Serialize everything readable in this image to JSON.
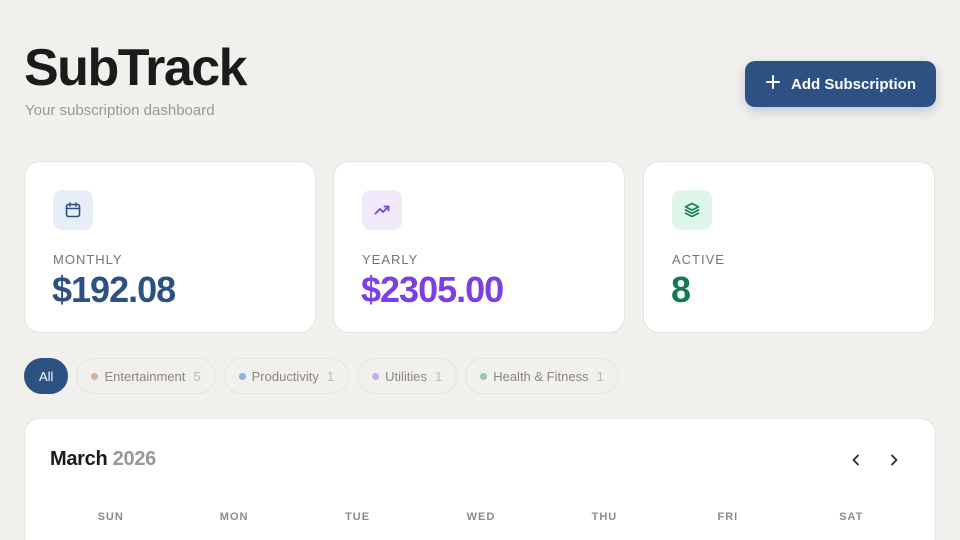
{
  "header": {
    "title": "SubTrack",
    "subtitle": "Your subscription dashboard",
    "add_button_label": "Add Subscription"
  },
  "stats": [
    {
      "label": "MONTHLY",
      "value": "$192.08",
      "icon": "calendar-icon",
      "color": "#2e5184",
      "icon_bg": "#e8eef7"
    },
    {
      "label": "YEARLY",
      "value": "$2305.00",
      "icon": "trending-up-icon",
      "color": "#7b3fe4",
      "icon_bg": "#f0eafb"
    },
    {
      "label": "ACTIVE",
      "value": "8",
      "icon": "layers-icon",
      "color": "#137a52",
      "icon_bg": "#def5ea"
    }
  ],
  "filters": {
    "all_label": "All",
    "categories": [
      {
        "label": "Entertainment",
        "count": "5",
        "color": "#d4b59c"
      },
      {
        "label": "Productivity",
        "count": "1",
        "color": "#8fb3d6"
      },
      {
        "label": "Utilities",
        "count": "1",
        "color": "#c9a9e6"
      },
      {
        "label": "Health & Fitness",
        "count": "1",
        "color": "#92c9ad"
      }
    ]
  },
  "calendar": {
    "month": "March",
    "year": "2026",
    "weekdays": [
      "SUN",
      "MON",
      "TUE",
      "WED",
      "THU",
      "FRI",
      "SAT"
    ]
  },
  "colors": {
    "accent": "#2e5184",
    "background": "#f2f0ed"
  }
}
